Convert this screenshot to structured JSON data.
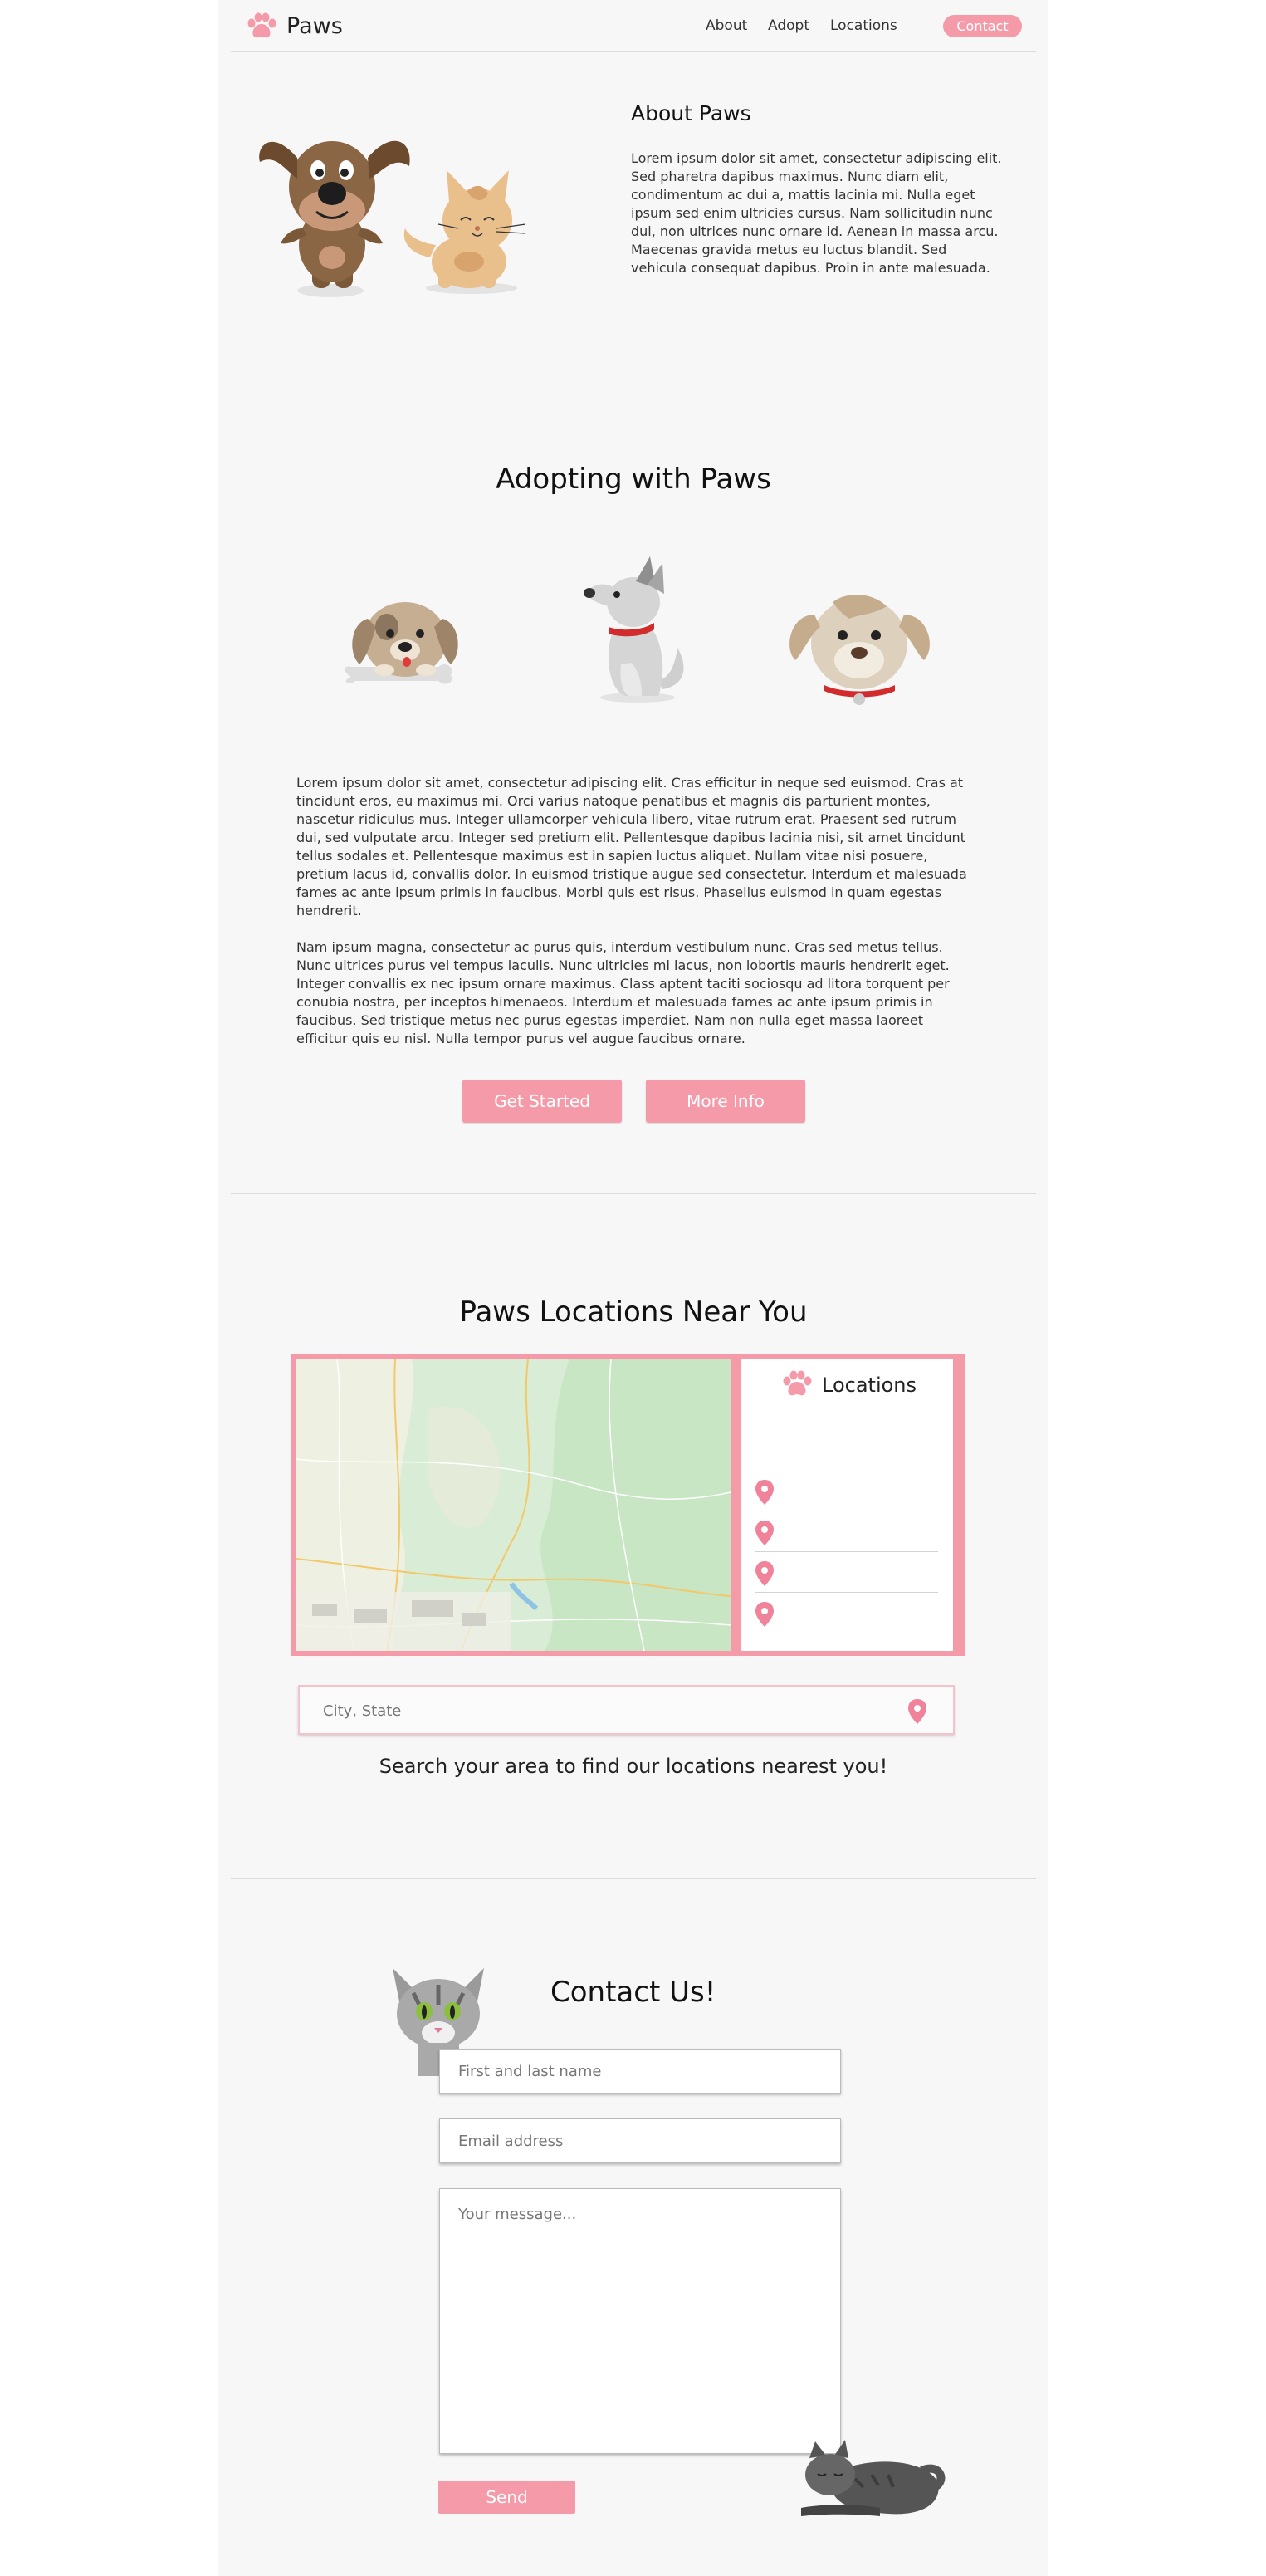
{
  "header": {
    "brand": "Paws",
    "nav": [
      "About",
      "Adopt",
      "Locations"
    ],
    "contact_label": "Contact",
    "accent_color": "#f59aa9"
  },
  "about": {
    "title": "About Paws",
    "text": "Lorem ipsum dolor sit amet, consectetur adipiscing elit. Sed pharetra dapibus maximus. Nunc diam elit, condimentum ac dui a, mattis lacinia mi. Nulla eget ipsum sed enim ultricies cursus. Nam sollicitudin nunc dui, non ultrices nunc ornare id. Aenean in massa arcu. Maecenas gravida metus eu luctus blandit. Sed vehicula consequat dapibus. Proin in ante malesuada."
  },
  "adopt": {
    "title": "Adopting with Paws",
    "paragraph1": "Lorem ipsum dolor sit amet, consectetur adipiscing elit. Cras efficitur in neque sed euismod. Cras at tincidunt eros, eu maximus mi. Orci varius natoque penatibus et magnis dis parturient montes, nascetur ridiculus mus. Integer ullamcorper vehicula libero, vitae rutrum erat. Praesent sed rutrum dui, sed vulputate arcu. Integer sed pretium elit. Pellentesque dapibus lacinia nisi, sit amet tincidunt tellus sodales et. Pellentesque maximus est in sapien luctus aliquet. Nullam vitae nisi posuere, pretium lacus id, convallis dolor. In euismod tristique augue sed consectetur. Interdum et malesuada fames ac ante ipsum primis in faucibus. Morbi quis est risus. Phasellus euismod in quam egestas hendrerit.",
    "paragraph2": "Nam ipsum magna, consectetur ac purus quis, interdum vestibulum nunc. Cras sed metus tellus. Nunc ultrices purus vel tempus iaculis. Nunc ultricies mi lacus, non lobortis mauris hendrerit eget. Integer convallis ex nec ipsum ornare maximus. Class aptent taciti sociosqu ad litora torquent per conubia nostra, per inceptos himenaeos. Interdum et malesuada fames ac ante ipsum primis in faucibus. Sed tristique metus nec purus egestas imperdiet. Nam non nulla eget massa laoreet efficitur quis eu nisl. Nulla tempor purus vel augue faucibus ornare.",
    "get_started_label": "Get Started",
    "more_info_label": "More Info"
  },
  "locations": {
    "title": "Paws Locations Near You",
    "panel_title": "Locations",
    "search_placeholder": "City, State",
    "caption": "Search your area to find our locations nearest you!",
    "pins": [
      "map-pin-icon",
      "map-pin-icon",
      "map-pin-icon",
      "map-pin-icon"
    ]
  },
  "contact": {
    "title": "Contact Us!",
    "name_placeholder": "First and last name",
    "email_placeholder": "Email address",
    "message_placeholder": "Your message...",
    "send_label": "Send"
  }
}
